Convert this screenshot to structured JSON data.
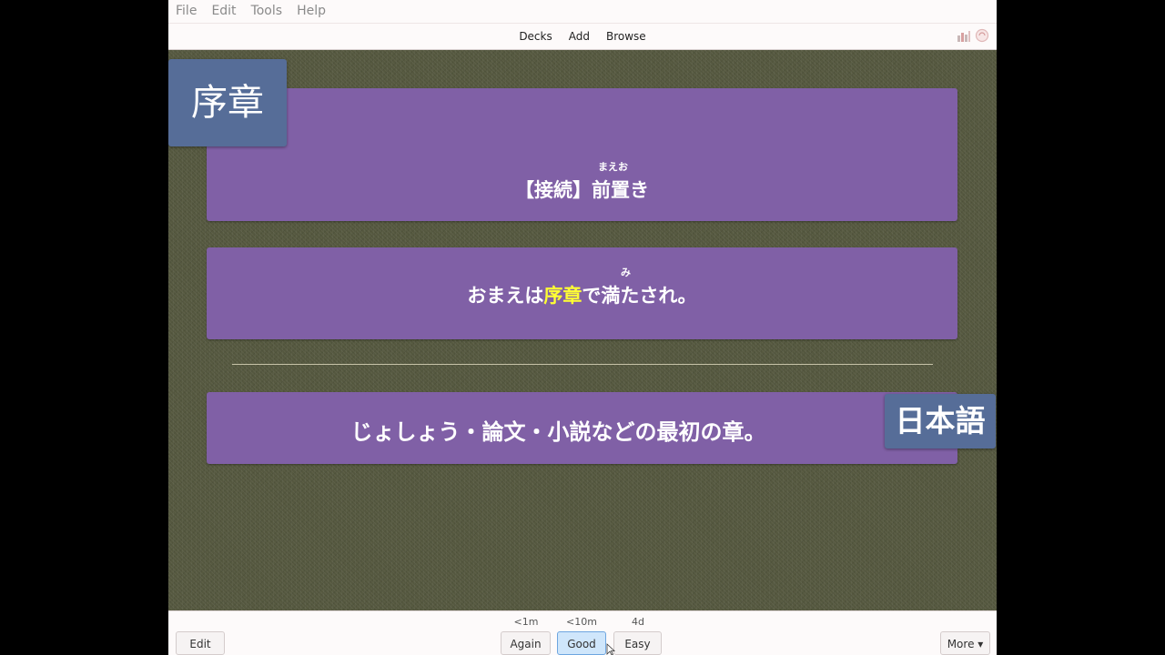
{
  "menu": {
    "items": [
      "File",
      "Edit",
      "Tools",
      "Help"
    ]
  },
  "toolbar": {
    "decks": "Decks",
    "add": "Add",
    "browse": "Browse",
    "icons": [
      "stats-icon",
      "sync-icon"
    ]
  },
  "card": {
    "kanji_tag": "序章",
    "language_tag": "日本語",
    "grammar_line": "【接続】前置き",
    "grammar_reading": "まえお",
    "sentence_prefix": "おまえは",
    "sentence_highlight": "序章",
    "sentence_suffix": "で満たされ。",
    "sentence_reading": "み",
    "definition": "じょしょう・論文・小説などの最初の章。",
    "highlight_color": "#ffff33",
    "panel_color": "#8060a6",
    "tag_color": "#566d98"
  },
  "answer_buttons": {
    "edit": "Edit",
    "again": "Again",
    "good": "Good",
    "easy": "Easy",
    "more": "More ▾",
    "again_interval": "<1m",
    "good_interval": "<10m",
    "easy_interval": "4d"
  }
}
